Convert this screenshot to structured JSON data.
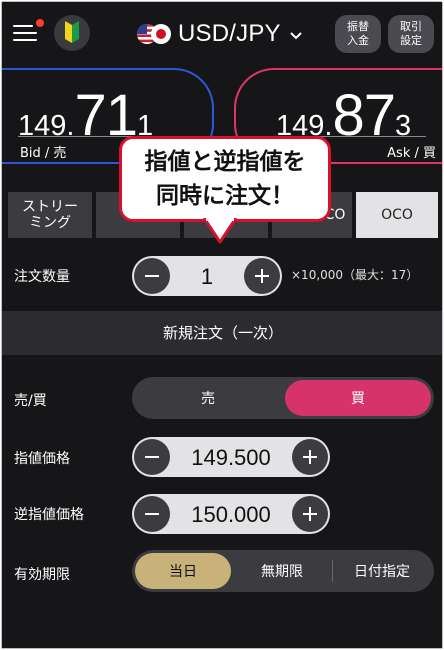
{
  "header": {
    "pair_label": "USD/JPY",
    "transfer_button": "振替\n入金",
    "trade_settings_button": "取引\n設定",
    "icons": [
      "menu-icon",
      "beginner-mark-icon",
      "us-flag-icon",
      "japan-flag-icon",
      "chevron-down-icon"
    ]
  },
  "rates": {
    "bid": {
      "part1": "149.",
      "part2": "71",
      "part3": "1",
      "label": "Bid / 売"
    },
    "ask": {
      "part1": "149.",
      "part2": "87",
      "part3": "3",
      "label": "Ask / 買"
    }
  },
  "tabs": {
    "streaming": "ストリー\nミング",
    "ifd_visible": "CO",
    "oco": "OCO"
  },
  "callout": {
    "line1": "指値と逆指値を",
    "line2": "同時に注文！"
  },
  "order": {
    "quantity_label": "注文数量",
    "quantity_value": "1",
    "quantity_unit": "×10,000（最大：17）",
    "section_title": "新規注文（一次）",
    "side_label": "売/買",
    "side_sell": "売",
    "side_buy": "買",
    "limit_label": "指値価格",
    "limit_value": "149.500",
    "stop_label": "逆指値価格",
    "stop_value": "150.000",
    "expiry_label": "有効期限",
    "expiry_options": [
      "当日",
      "無期限",
      "日付指定"
    ]
  },
  "colors": {
    "background": "#161618",
    "bid_blue": "#2e58d6",
    "ask_pink": "#e0356b",
    "buy_selected": "#d6336a",
    "today_selected": "#c9b27a",
    "callout_red": "#d8102a"
  }
}
